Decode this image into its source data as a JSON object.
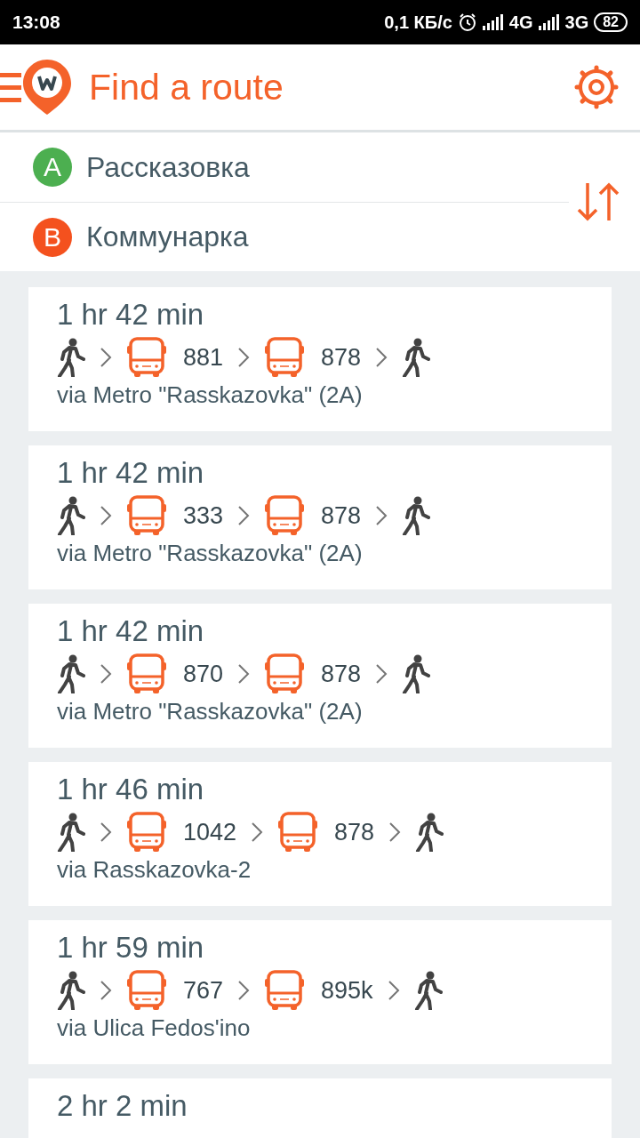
{
  "status_bar": {
    "time": "13:08",
    "speed": "0,1 КБ/с",
    "network_1": "4G",
    "network_2": "3G",
    "battery": "82"
  },
  "header": {
    "title": "Find a route"
  },
  "points": [
    {
      "badge": "A",
      "name": "Рассказовка",
      "color": "#4caf50"
    },
    {
      "badge": "B",
      "name": "Коммунарка",
      "color": "#f4511e"
    }
  ],
  "routes": [
    {
      "duration": "1 hr 42 min",
      "legs": [
        {
          "kind": "walk"
        },
        {
          "kind": "bus",
          "number": "881"
        },
        {
          "kind": "bus",
          "number": "878"
        },
        {
          "kind": "walk"
        }
      ],
      "via": "via Metro \"Rasskazovka\" (2A)"
    },
    {
      "duration": "1 hr 42 min",
      "legs": [
        {
          "kind": "walk"
        },
        {
          "kind": "bus",
          "number": "333"
        },
        {
          "kind": "bus",
          "number": "878"
        },
        {
          "kind": "walk"
        }
      ],
      "via": "via Metro \"Rasskazovka\" (2A)"
    },
    {
      "duration": "1 hr 42 min",
      "legs": [
        {
          "kind": "walk"
        },
        {
          "kind": "bus",
          "number": "870"
        },
        {
          "kind": "bus",
          "number": "878"
        },
        {
          "kind": "walk"
        }
      ],
      "via": "via Metro \"Rasskazovka\" (2A)"
    },
    {
      "duration": "1 hr 46 min",
      "legs": [
        {
          "kind": "walk"
        },
        {
          "kind": "bus",
          "number": "1042"
        },
        {
          "kind": "bus",
          "number": "878"
        },
        {
          "kind": "walk"
        }
      ],
      "via": "via Rasskazovka-2"
    },
    {
      "duration": "1 hr 59 min",
      "legs": [
        {
          "kind": "walk"
        },
        {
          "kind": "bus",
          "number": "767"
        },
        {
          "kind": "bus",
          "number": "895k"
        },
        {
          "kind": "walk"
        }
      ],
      "via": "via Ulica Fedos'ino"
    },
    {
      "duration": "2 hr 2 min"
    }
  ]
}
